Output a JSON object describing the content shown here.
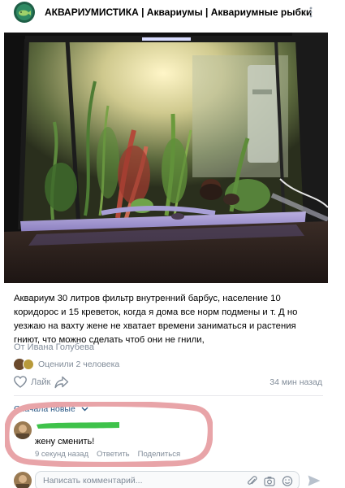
{
  "header": {
    "group_name": "АКВАРИУМИСТИКА | Аквариумы | Аквариумные рыбки",
    "more_icon": "more-vertical-icon",
    "avatar_icon": "fish-avatar-icon"
  },
  "post": {
    "photo_icon": "aquarium-photo",
    "text": "Аквариум 30 литров фильтр внутренний барбус, население 10 коридорос и 15 креветок, когда я дома все норм подмены и т. Д но уезжаю на вахту жене не хватает времени заниматься и растения гниют, что можно сделать чтоб они не гнили,",
    "author_prefix": "От",
    "author_name": "Ивана Голубева",
    "rated_text": "Оценили 2 человека",
    "like_label": "Лайк",
    "time": "34 мин назад"
  },
  "comments": {
    "sort_label": "Сначала новые",
    "items": [
      {
        "author_name": "",
        "text": "жену сменить!",
        "time": "9 секунд назад",
        "reply_label": "Ответить",
        "share_label": "Поделиться"
      }
    ]
  },
  "comment_bar": {
    "placeholder": "Написать комментарий..."
  },
  "colors": {
    "link": "#2a5885",
    "secondary": "#818c99",
    "highlight": "#e8a4a8",
    "redaction": "#3ec24a",
    "send": "#b8c1cc"
  }
}
